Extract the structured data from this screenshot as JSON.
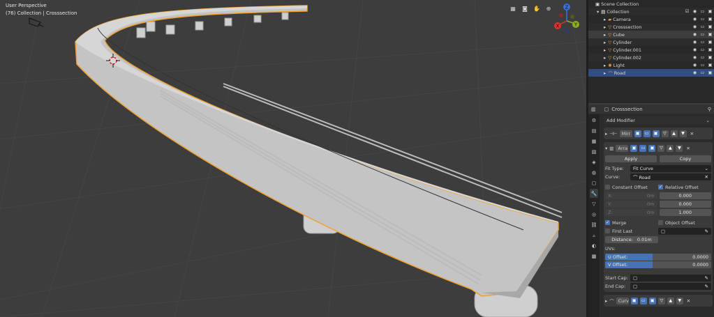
{
  "viewport": {
    "title": "User Perspective",
    "subtitle": "(76) Collection | Crosssection",
    "gizmo": {
      "z": "Z",
      "y": "Y",
      "x": "X"
    },
    "tools": [
      "grid-icon",
      "camera-icon",
      "hand-icon",
      "zoom-icon"
    ]
  },
  "outliner": {
    "root": "Scene Collection",
    "collection": "Collection",
    "items": [
      {
        "name": "Camera",
        "icon": "camera-icon",
        "color": "#e5a050"
      },
      {
        "name": "Crosssection",
        "icon": "mesh-icon",
        "color": "#e5a050"
      },
      {
        "name": "Cube",
        "icon": "mesh-icon",
        "color": "#e5a050"
      },
      {
        "name": "Cylinder",
        "icon": "mesh-icon",
        "color": "#e5a050"
      },
      {
        "name": "Cylinder.001",
        "icon": "mesh-icon",
        "color": "#e5a050"
      },
      {
        "name": "Cylinder.002",
        "icon": "mesh-icon",
        "color": "#e5a050"
      },
      {
        "name": "Light",
        "icon": "light-icon",
        "color": "#e5a050"
      },
      {
        "name": "Road",
        "icon": "curve-icon",
        "color": "#e5a050"
      }
    ]
  },
  "properties": {
    "object_name": "Crosssection",
    "add_modifier": "Add Modifier",
    "mod_mirror": "Mirr",
    "mod_array": "Arra",
    "mod_curve": "Curv",
    "apply": "Apply",
    "copy": "Copy",
    "fit_type_label": "Fit Type:",
    "fit_type": "Fit Curve",
    "curve_label": "Curve:",
    "curve_value": "Road",
    "constant_offset": "Constant Offset",
    "relative_offset": "Relative Offset",
    "x_label": "X:",
    "y_label": "Y:",
    "z_label": "Z:",
    "const_x": "0m",
    "const_y": "0m",
    "const_z": "0m",
    "rel_x": "0.000",
    "rel_y": "0.000",
    "rel_z": "1.000",
    "merge": "Merge",
    "object_offset": "Object Offset",
    "first_last": "First Last",
    "distance_label": "Distance:",
    "distance": "0.01m",
    "uvs": "UVs:",
    "u_offset_label": "U Offset:",
    "u_offset": "0.0000",
    "v_offset_label": "V Offset:",
    "v_offset": "0.0000",
    "start_cap": "Start Cap:",
    "end_cap": "End Cap:"
  }
}
